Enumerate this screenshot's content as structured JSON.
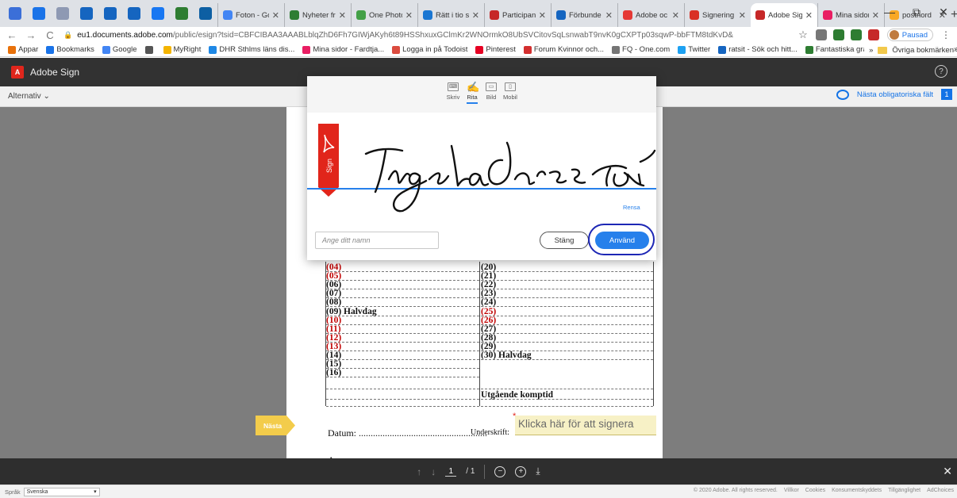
{
  "browser": {
    "tabs": [
      {
        "label": "Foton - Go",
        "color": "#4285f4"
      },
      {
        "label": "Nyheter frå",
        "color": "#2e7d32"
      },
      {
        "label": "One Photo",
        "color": "#43a047"
      },
      {
        "label": "Rätt i tio s",
        "color": "#1976d2"
      },
      {
        "label": "Participan",
        "color": "#c62828"
      },
      {
        "label": "Förbunde",
        "color": "#1565c0"
      },
      {
        "label": "Adobe oc",
        "color": "#e53935"
      },
      {
        "label": "Signering",
        "color": "#d93025"
      },
      {
        "label": "Adobe Sig",
        "color": "#c62828",
        "active": true
      },
      {
        "label": "Mina sidor",
        "color": "#e91e63"
      },
      {
        "label": "postnord",
        "color": "#f9a825"
      }
    ],
    "pinned_colors": [
      "#3b6fd8",
      "#1a73e8",
      "#8e99b3",
      "#1565c0",
      "#1565c0",
      "#1565c0",
      "#1877f2",
      "#2e7d32",
      "#0d5fa3"
    ],
    "new_tab": "+",
    "window_controls": [
      "—",
      "⧉",
      "✕"
    ],
    "address": {
      "host": "eu1.documents.adobe.com",
      "path": "/public/esign?tsid=CBFCIBAA3AAABLblqZhD6Fh7GIWjAKyh6t89HSShxuxGClmKr2WNOrmkO8UbSVCitovSqLsnwabT9nvK0gCXPTp03sqwP-bbFTM8tdKvD&",
      "back": "←",
      "forward": "→",
      "reload": "C",
      "star": "☆"
    },
    "profile_label": "Pausad",
    "extension_colors": [
      "#777777",
      "#2e7d32",
      "#2e7d32",
      "#c62828"
    ],
    "bookmarks": [
      {
        "label": "Appar",
        "color": "#e8710a"
      },
      {
        "label": "Bookmarks",
        "color": "#1a73e8"
      },
      {
        "label": "Google",
        "color": "#4285f4"
      },
      {
        "label": "",
        "color": "#555555"
      },
      {
        "label": "MyRight",
        "color": "#f4b400"
      },
      {
        "label": "DHR Sthlms läns dis...",
        "color": "#1e88e5"
      },
      {
        "label": "Mina sidor - Fardtja...",
        "color": "#e91e63"
      },
      {
        "label": "Logga in på Todoist",
        "color": "#db4c3f"
      },
      {
        "label": "Pinterest",
        "color": "#e60023"
      },
      {
        "label": "Forum Kvinnor och...",
        "color": "#d32f2f"
      },
      {
        "label": "FQ - One.com",
        "color": "#757575"
      },
      {
        "label": "Twitter",
        "color": "#1da1f2"
      },
      {
        "label": "ratsit - Sök och hitt...",
        "color": "#1565c0"
      },
      {
        "label": "Fantastiska gratisbil...",
        "color": "#2e7d32"
      },
      {
        "label": "Microsoft Office Sta...",
        "color": "#d83b01"
      }
    ],
    "bookmarks_more": "»",
    "bookmarks_other": "Övriga bokmärken"
  },
  "app": {
    "title": "Adobe Sign",
    "logo_text": "A",
    "help": "?"
  },
  "options_bar": {
    "options_label": "Alternativ ⌄",
    "next_required": "Nästa obligatoriska fält",
    "required_count": "1"
  },
  "document": {
    "left_rows": [
      {
        "text": "(04)",
        "red": true
      },
      {
        "text": "(05)",
        "red": true
      },
      {
        "text": "(06)",
        "red": false
      },
      {
        "text": "(07)",
        "red": false
      },
      {
        "text": "(08)",
        "red": false
      },
      {
        "text": "(09) Halvdag",
        "red": false
      },
      {
        "text": "(10)",
        "red": true
      },
      {
        "text": "(11)",
        "red": true
      },
      {
        "text": "(12)",
        "red": true
      },
      {
        "text": "(13)",
        "red": true
      },
      {
        "text": "(14)",
        "red": false
      },
      {
        "text": "(15)",
        "red": false
      },
      {
        "text": "(16)",
        "red": false
      }
    ],
    "right_rows": [
      {
        "text": "(20)",
        "red": false
      },
      {
        "text": "(21)",
        "red": false
      },
      {
        "text": "(22)",
        "red": false
      },
      {
        "text": "(23)",
        "red": false
      },
      {
        "text": "(24)",
        "red": false
      },
      {
        "text": "(25)",
        "red": true
      },
      {
        "text": "(26)",
        "red": true
      },
      {
        "text": "(27)",
        "red": false
      },
      {
        "text": "(28)",
        "red": false
      },
      {
        "text": "(29)",
        "red": false
      },
      {
        "text": "(30) Halvdag",
        "red": false
      }
    ],
    "outgoing_label": "Utgående komptid",
    "date_label": "Datum: ......................................................",
    "signature_label": "Underskrift:",
    "sign_field_text": "Klicka här för att signera",
    "next_tag": "Nästa",
    "partial_text": "A"
  },
  "page_nav": {
    "current": "1",
    "total": "/ 1",
    "up": "↑",
    "down": "↓",
    "zoom_out": "−",
    "zoom_in": "+",
    "download": "⤓",
    "close": "✕"
  },
  "footer": {
    "language_label": "Språk",
    "language_value": "Svenska",
    "links": [
      "© 2020 Adobe. All rights reserved.",
      "Villkor",
      "Cookies",
      "Konsumentskyddets",
      "Tillgänglighet",
      "AdChoices"
    ]
  },
  "modal": {
    "tabs": [
      {
        "label": "Skriv",
        "icon": "⌨"
      },
      {
        "label": "Rita",
        "icon": "✍",
        "active": true
      },
      {
        "label": "Bild",
        "icon": "▭"
      },
      {
        "label": "Mobil",
        "icon": "▯"
      }
    ],
    "badge_text": "Sign",
    "clear_label": "Rensa",
    "name_placeholder": "Ange ditt namn",
    "close_label": "Stäng",
    "apply_label": "Använd"
  }
}
